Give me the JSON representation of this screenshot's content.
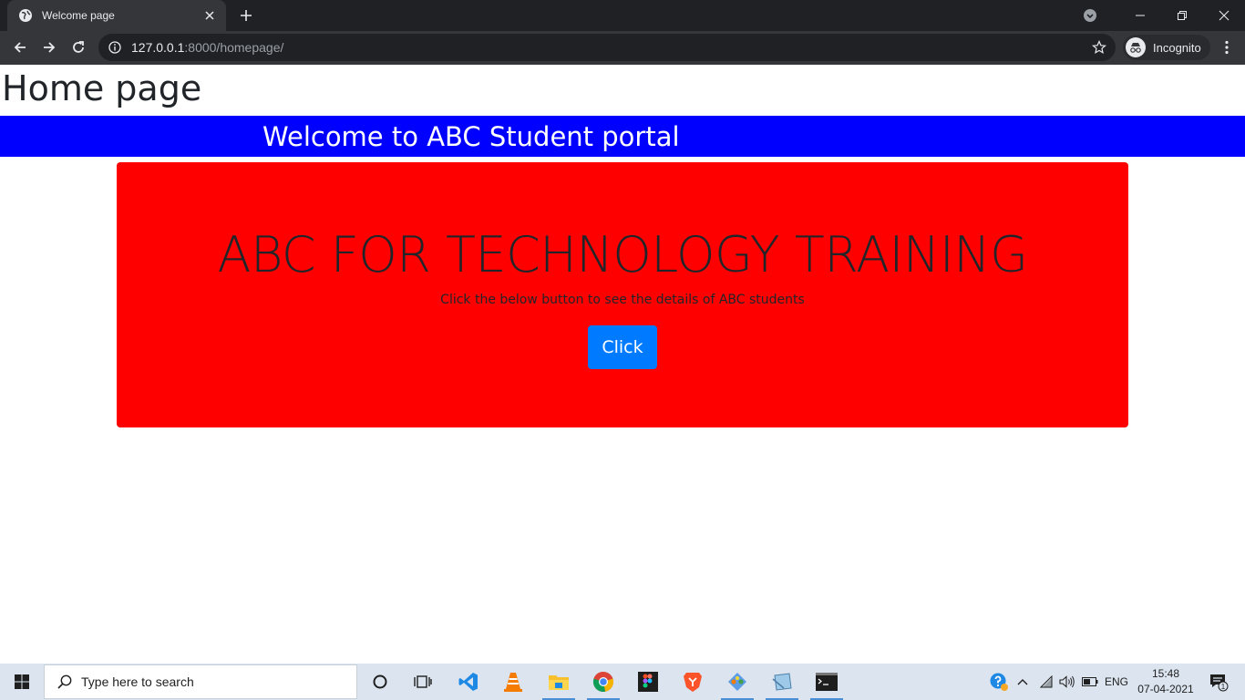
{
  "browser": {
    "tab_title": "Welcome page",
    "url_host": "127.0.0.1",
    "url_path": ":8000/homepage/",
    "profile_label": "Incognito"
  },
  "page": {
    "title": "Home page",
    "banner": "Welcome to ABC Student portal",
    "jumbotron": {
      "heading": "ABC FOR TECHNOLOGY TRAINING",
      "subtext": "Click the below button to see the details of ABC students",
      "button_label": "Click"
    },
    "colors": {
      "banner_bg": "#0000ff",
      "jumbotron_bg": "#ff0000",
      "button_bg": "#007bff"
    }
  },
  "taskbar": {
    "search_placeholder": "Type here to search",
    "apps": [
      "cortana-icon",
      "task-view-icon",
      "vscode-icon",
      "vlc-icon",
      "file-explorer-icon",
      "chrome-icon",
      "figma-icon",
      "brave-icon",
      "app-icon",
      "notepad-icon",
      "terminal-icon"
    ],
    "language": "ENG",
    "time": "15:48",
    "date": "07-04-2021",
    "notification_count": "1"
  }
}
